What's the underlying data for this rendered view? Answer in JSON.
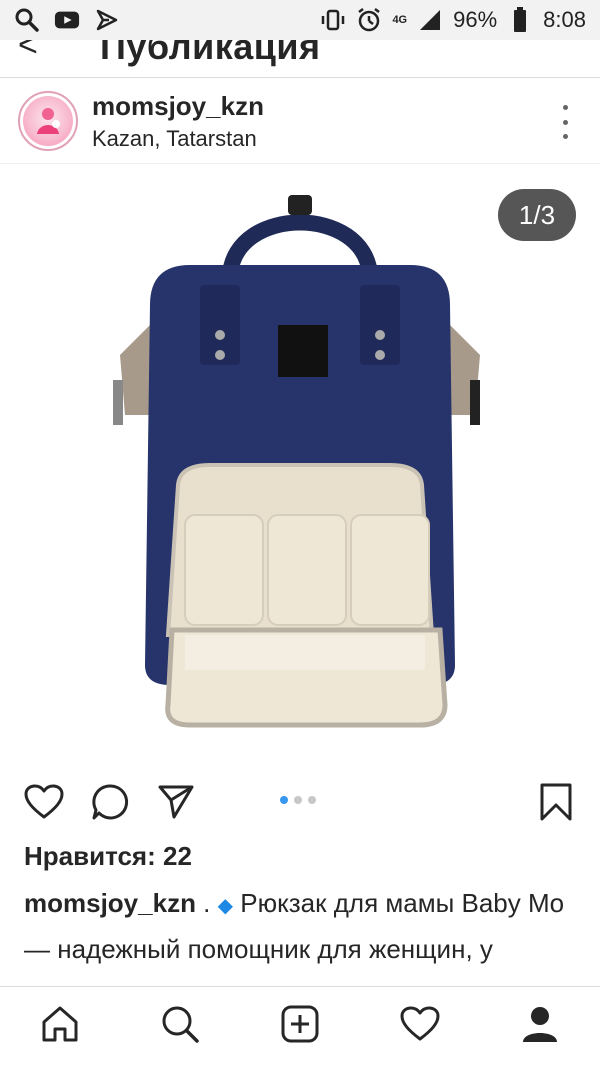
{
  "status_bar": {
    "battery": "96%",
    "time": "8:08",
    "network": "4G"
  },
  "header": {
    "title": "Публикация"
  },
  "post": {
    "username": "momsjoy_kzn",
    "location": "Kazan, Tatarstan",
    "media_counter": "1/3",
    "media_alt": "Navy blue diaper backpack with beige interior",
    "likes_text": "Нравится: 22",
    "caption_username": "momsjoy_kzn",
    "caption_separator": " . ",
    "caption_text": " Рюкзак для мамы Baby Mo — надежный помощник для женщин, у которых каждая секунда на"
  },
  "carousel": {
    "total": 3,
    "active_index": 0
  },
  "colors": {
    "accent_blue": "#3897f0",
    "text": "#262626",
    "border": "#dbdbdb"
  },
  "icons": {
    "statusbar_left": [
      "search-icon",
      "youtube-icon",
      "notification-icon"
    ],
    "statusbar_right": [
      "vibrate-icon",
      "alarm-icon",
      "signal-icon",
      "battery-icon"
    ],
    "actions": [
      "heart-icon",
      "comment-icon",
      "share-icon",
      "bookmark-icon"
    ],
    "nav": [
      "home-icon",
      "search-icon",
      "add-icon",
      "activity-icon",
      "profile-icon"
    ]
  }
}
